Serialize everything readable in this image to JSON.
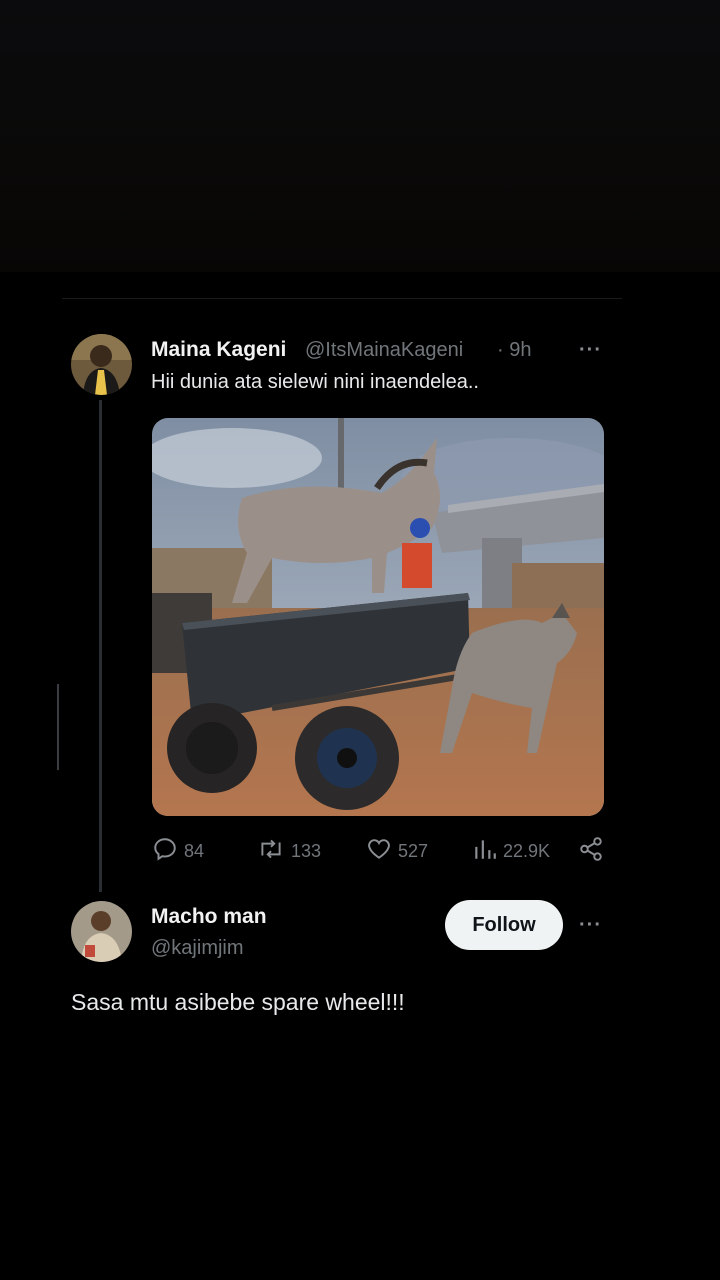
{
  "post": {
    "author_name": "Maina Kageni",
    "author_handle": "@ItsMainaKageni",
    "time": "· 9h",
    "more": "···",
    "text": "Hii dunia ata sielewi nini inaendelea..",
    "media_icon": "donkey-cart-photo",
    "stats": {
      "replies": "84",
      "reposts": "133",
      "likes": "527",
      "views": "22.9K"
    },
    "icons": [
      "reply-icon",
      "repost-icon",
      "like-icon",
      "views-icon",
      "share-icon"
    ]
  },
  "reply": {
    "author_name": "Macho man",
    "author_handle": "@kajimjim",
    "follow_label": "Follow",
    "more": "···",
    "text": "Sasa mtu asibebe spare wheel!!!"
  },
  "colors": {
    "background": "#000000",
    "text": "#e7e9ea",
    "muted": "#71767b",
    "follow_bg": "#eff3f4"
  }
}
